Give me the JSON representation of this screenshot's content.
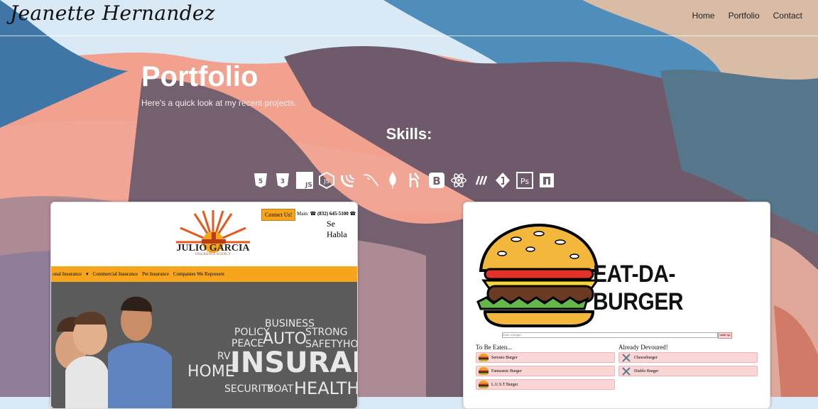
{
  "header": {
    "logo": "Jeanette Hernandez",
    "nav": [
      "Home",
      "Portfolio",
      "Contact"
    ]
  },
  "hero": {
    "title": "Portfolio",
    "subtitle": "Here's a quick look at my recent projects."
  },
  "skills": {
    "heading": "Skills:",
    "icons": [
      "html5-icon",
      "css3-icon",
      "javascript-icon",
      "nodejs-icon",
      "jquery-icon",
      "mysql-icon",
      "mongodb-icon",
      "handlebars-icon",
      "bootstrap-icon",
      "react-icon",
      "express-icon",
      "heroku-icon",
      "photoshop-icon",
      "npm-icon"
    ]
  },
  "project1": {
    "contact_button": "Contact Us!",
    "main_phone": "Main:",
    "phone": "(832) 645-5100",
    "se_habla": "Se Habla",
    "brand": "JULIO GARCIA",
    "brand_sub": "INSURANCE AGENCY",
    "menu": [
      "onal Insurance",
      "Commercial Insurance",
      "Pet Insurance",
      "Companies We Represent"
    ],
    "words": [
      "POLICY",
      "BUSINESS",
      "STRONG",
      "PEACE",
      "AUTO",
      "SAFETY",
      "HOM",
      "RV",
      "HOME",
      "INSURANC",
      "SECURITY",
      "BOAT",
      "HEALTH"
    ]
  },
  "project2": {
    "title": "EAT-DA-BURGER",
    "input_placeholder": "Enter a burger!",
    "order_button": "order up",
    "to_be_eaten": "To Be Eaten...",
    "already_devoured": "Already Devoured!",
    "to_eat": [
      "Serrano Burger",
      "Fantasmic Burger",
      "L.U.S.T Burger"
    ],
    "devoured": [
      "Cheeseburger",
      "Diablo Burger"
    ]
  },
  "colors": {
    "sky": "#d9e9f5",
    "salmon": "#f0a08e",
    "mauve": "#74606f",
    "blue": "#4e7fa7",
    "tan": "#d7b89e",
    "orange": "#f7a51d"
  }
}
